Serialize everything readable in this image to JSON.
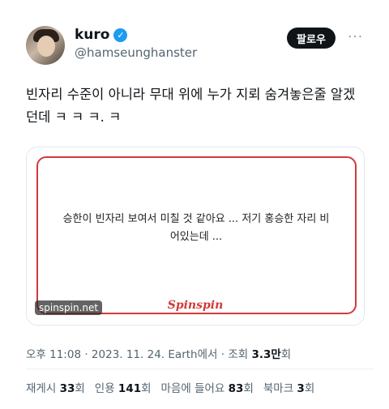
{
  "user": {
    "name": "kuro",
    "handle": "@hamseunghanster",
    "follow_label": "팔로우",
    "more_label": "···"
  },
  "tweet": {
    "text_line1": "빈자리 수준이 아니라 무대 위에 누가 지뢰 숨겨놓은줄 알겠",
    "text_line2": "던데 ㅋ ㅋ ㅋ. ㅋ"
  },
  "card": {
    "quote_line1": "승한이 빈자리 보여서 미칠 것 같아요 ... 저기 홍승한 자리 비",
    "quote_line2": "어있는데 ...",
    "brand": "Spinspin",
    "domain": "spinspin.net",
    "accent_color": "#d23a3a"
  },
  "meta": {
    "time": "오후 11:08",
    "date": "2023. 11. 24.",
    "source": "Earth에서",
    "views_label": "조회",
    "views_value": "3.3만",
    "views_unit": "회"
  },
  "stats": [
    {
      "label": "재게시",
      "value": "33",
      "unit": "회"
    },
    {
      "label": "인용",
      "value": "141",
      "unit": "회"
    },
    {
      "label": "마음에 들어요",
      "value": "83",
      "unit": "회"
    },
    {
      "label": "북마크",
      "value": "3",
      "unit": "회"
    }
  ]
}
